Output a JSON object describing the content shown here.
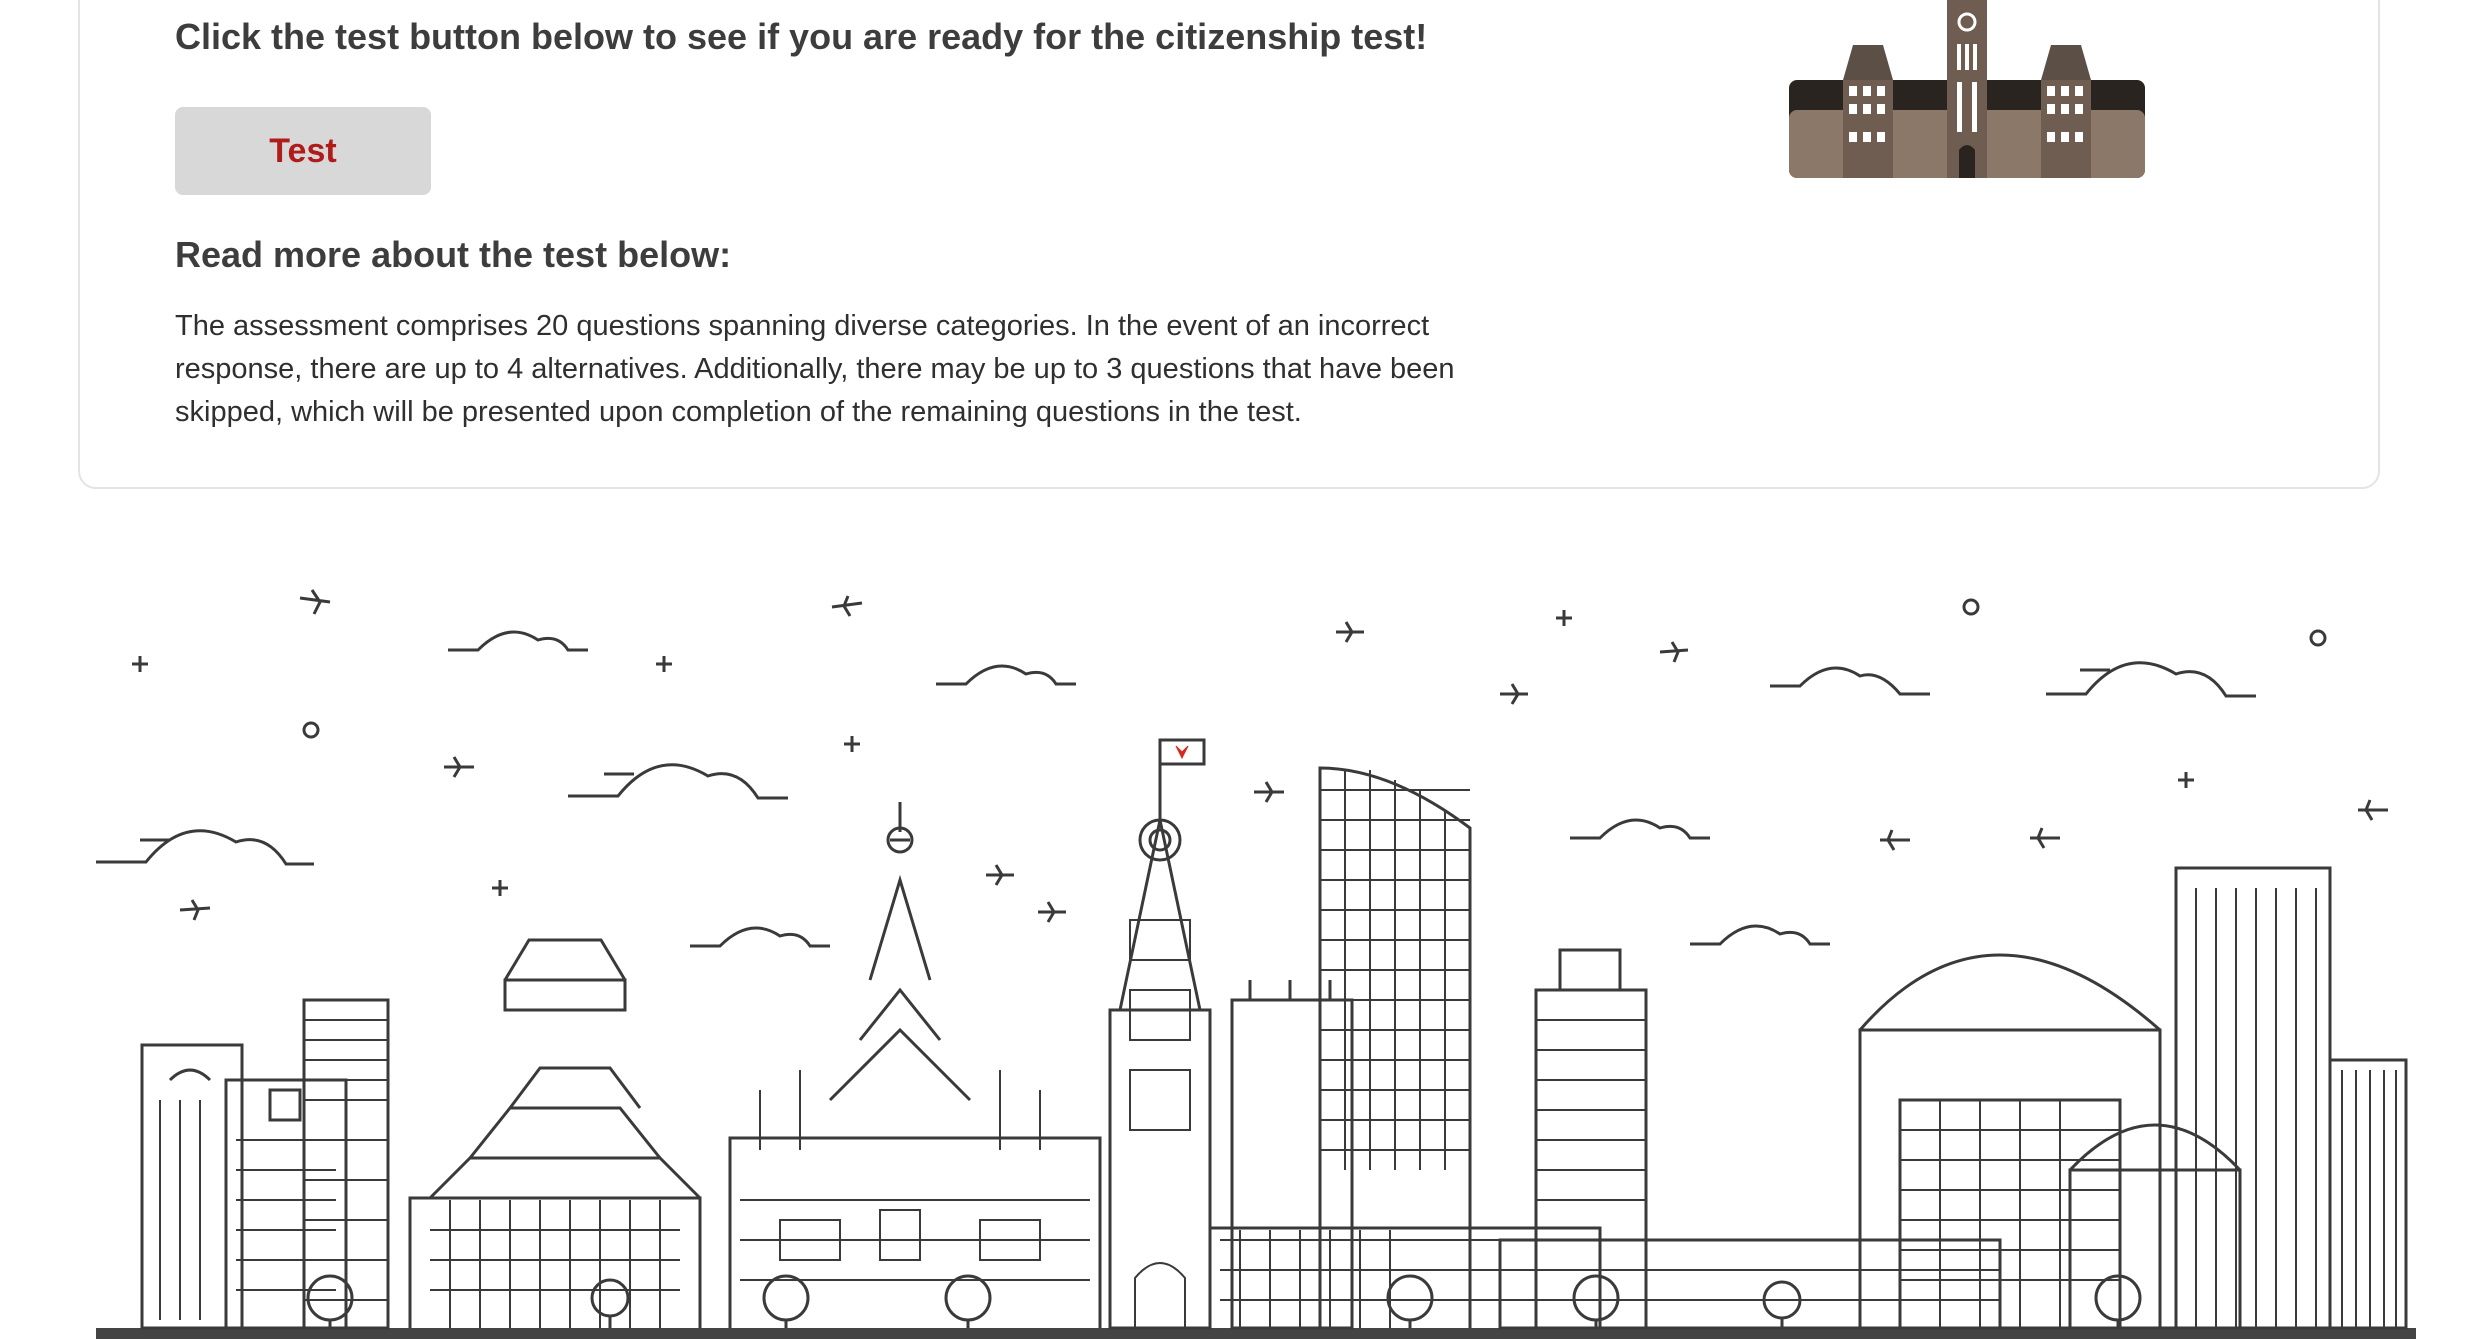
{
  "intro": {
    "headline": "Click the test button below to see if you are ready for the citizenship test!",
    "test_button_label": "Test"
  },
  "about": {
    "heading": "Read more about the test below:",
    "description": "The assessment comprises 20 questions spanning diverse categories. In the event of an incorrect response, there are up to 4 alternatives. Additionally, there may be up to 3 questions that have been skipped, which will be presented upon completion of the remaining questions in the test."
  },
  "colors": {
    "accent_red": "#b01c1c",
    "button_bg": "#d8d8d8",
    "card_border": "#e4e4e4",
    "text_dark": "#3d3d3d",
    "flag_red": "#d52b1e"
  },
  "icons": {
    "thumbnail": "parliament-building-icon",
    "illustration": "ottawa-skyline-illustration"
  }
}
